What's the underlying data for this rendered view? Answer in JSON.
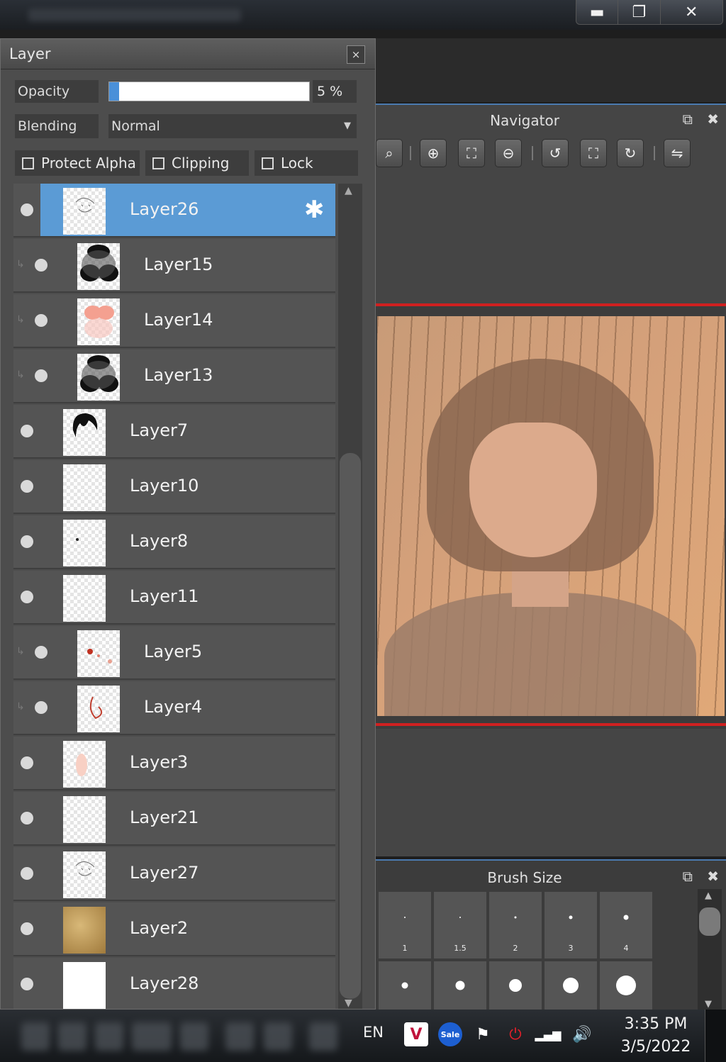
{
  "window_controls": {
    "minimize": "▬",
    "restore": "❐",
    "close": "✕"
  },
  "layer_panel": {
    "title": "Layer",
    "close": "×",
    "opacity_label": "Opacity",
    "opacity_value": "5 %",
    "opacity_percent": 5,
    "blending_label": "Blending",
    "blending_value": "Normal",
    "protect_alpha": "Protect Alpha",
    "clipping": "Clipping",
    "lock": "Lock",
    "layers": [
      {
        "name": "Layer26",
        "selected": true,
        "clipped": false,
        "thumb": "sketch"
      },
      {
        "name": "Layer15",
        "selected": false,
        "clipped": true,
        "thumb": "dark"
      },
      {
        "name": "Layer14",
        "selected": false,
        "clipped": true,
        "thumb": "pink"
      },
      {
        "name": "Layer13",
        "selected": false,
        "clipped": true,
        "thumb": "dark"
      },
      {
        "name": "Layer7",
        "selected": false,
        "clipped": false,
        "thumb": "hair"
      },
      {
        "name": "Layer10",
        "selected": false,
        "clipped": false,
        "thumb": "empty"
      },
      {
        "name": "Layer8",
        "selected": false,
        "clipped": false,
        "thumb": "dot"
      },
      {
        "name": "Layer11",
        "selected": false,
        "clipped": false,
        "thumb": "empty"
      },
      {
        "name": "Layer5",
        "selected": false,
        "clipped": true,
        "thumb": "reddots"
      },
      {
        "name": "Layer4",
        "selected": false,
        "clipped": true,
        "thumb": "redline"
      },
      {
        "name": "Layer3",
        "selected": false,
        "clipped": false,
        "thumb": "lightpink"
      },
      {
        "name": "Layer21",
        "selected": false,
        "clipped": false,
        "thumb": "empty"
      },
      {
        "name": "Layer27",
        "selected": false,
        "clipped": false,
        "thumb": "sketch"
      },
      {
        "name": "Layer2",
        "selected": false,
        "clipped": false,
        "thumb": "paper"
      },
      {
        "name": "Layer28",
        "selected": false,
        "clipped": false,
        "thumb": "white"
      }
    ]
  },
  "navigator": {
    "title": "Navigator",
    "popout_icon": "⧉",
    "close_icon": "✖",
    "tools": [
      {
        "name": "zoom-fit-icon",
        "glyph": "⌕"
      },
      {
        "name": "zoom-in-icon",
        "glyph": "⊕"
      },
      {
        "name": "fit-screen-icon",
        "glyph": "⛶"
      },
      {
        "name": "zoom-out-icon",
        "glyph": "⊖"
      },
      {
        "name": "rotate-left-icon",
        "glyph": "↺"
      },
      {
        "name": "reset-view-icon",
        "glyph": "⛶"
      },
      {
        "name": "rotate-right-icon",
        "glyph": "↻"
      },
      {
        "name": "flip-icon",
        "glyph": "⇋"
      }
    ]
  },
  "brush_size": {
    "title": "Brush Size",
    "popout_icon": "⧉",
    "close_icon": "✖",
    "row1": [
      {
        "label": "1",
        "dot": 2
      },
      {
        "label": "1.5",
        "dot": 2
      },
      {
        "label": "2",
        "dot": 3
      },
      {
        "label": "3",
        "dot": 5
      },
      {
        "label": "4",
        "dot": 7
      }
    ],
    "row2": [
      {
        "dot": 9
      },
      {
        "dot": 13
      },
      {
        "dot": 18
      },
      {
        "dot": 22
      },
      {
        "dot": 28
      }
    ]
  },
  "taskbar": {
    "language": "EN",
    "time": "3:35 PM",
    "date": "3/5/2022",
    "tray_icons": [
      "vivaldi-icon",
      "sale-icon",
      "flag-icon",
      "power-icon",
      "signal-icon",
      "volume-icon"
    ]
  },
  "colors": {
    "selected_layer": "#5b9bd5",
    "panel_bg": "#4d4d4d",
    "red_frame": "#d02020"
  }
}
